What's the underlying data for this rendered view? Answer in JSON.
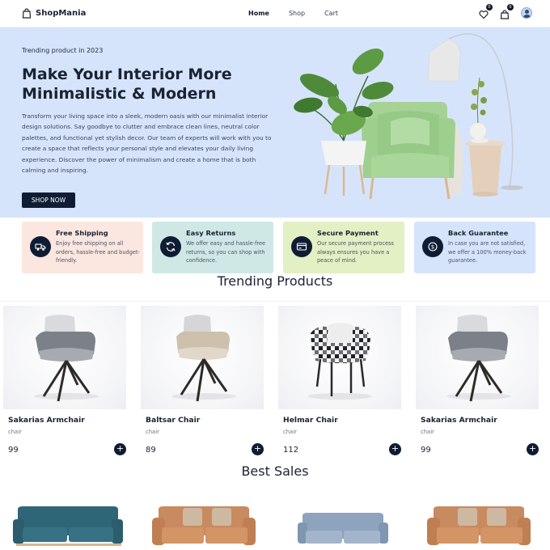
{
  "brand": {
    "name": "ShopMania",
    "icon": "shopping-bag-icon"
  },
  "nav": {
    "links": [
      {
        "label": "Home",
        "active": true
      },
      {
        "label": "Shop",
        "active": false
      },
      {
        "label": "Cart",
        "active": false
      }
    ],
    "wishlist_count": "0",
    "cart_count": "0",
    "icons": [
      "heart-icon",
      "cart-bag-icon",
      "user-avatar"
    ]
  },
  "hero": {
    "kicker": "Trending product in 2023",
    "title": "Make Your Interior More Minimalistic & Modern",
    "description": "Transform your living space into a sleek, modern oasis with our minimalist interior design solutions. Say goodbye to clutter and embrace clean lines, neutral color palettes, and functional yet stylish decor. Our team of experts will work with you to create a space that reflects your personal style and elevates your daily living experience. Discover the power of minimalism and create a home that is both calming and inspiring.",
    "button": "SHOP NOW"
  },
  "features": [
    {
      "title": "Free Shipping",
      "desc": "Enjoy free shipping on all orders, hassle-free and budget-friendly.",
      "icon": "truck-icon",
      "bg": "#fbe7e0"
    },
    {
      "title": "Easy Returns",
      "desc": "We offer easy and hassle-free returns, so you can shop with confidence.",
      "icon": "refresh-icon",
      "bg": "#cfe8e6"
    },
    {
      "title": "Secure Payment",
      "desc": "Our secure payment process always ensures you have a peace of mind.",
      "icon": "credit-card-icon",
      "bg": "#e2f0c4"
    },
    {
      "title": "Back Guarantee",
      "desc": "In case you are not satisfied, we offer a 100% money-back guarantee.",
      "icon": "money-back-icon",
      "bg": "#d6e4fb"
    }
  ],
  "trending": {
    "title": "Trending Products",
    "products": [
      {
        "name": "Sakarias Armchair",
        "category": "chair",
        "price": "99"
      },
      {
        "name": "Baltsar Chair",
        "category": "chair",
        "price": "89"
      },
      {
        "name": "Helmar Chair",
        "category": "chair",
        "price": "112"
      },
      {
        "name": "Sakarias Armchair",
        "category": "chair",
        "price": "99"
      }
    ],
    "add_label": "+"
  },
  "best_sales": {
    "title": "Best Sales",
    "items": [
      "teal-sofa",
      "tan-leather-sofa",
      "grey-blue-sofa",
      "tan-leather-sofa"
    ]
  },
  "colors": {
    "navy": "#0f1c33",
    "hero_bg": "#d6e4fb",
    "chair_green": "#9fcf8f"
  }
}
